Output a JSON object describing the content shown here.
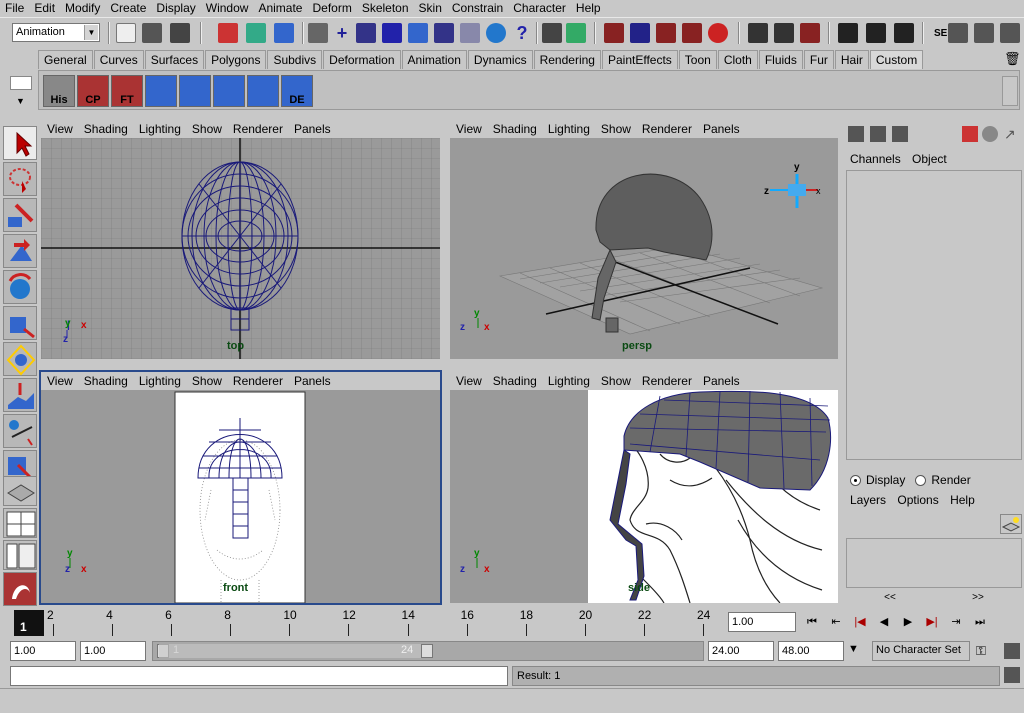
{
  "menubar": [
    "File",
    "Edit",
    "Modify",
    "Create",
    "Display",
    "Window",
    "Animate",
    "Deform",
    "Skeleton",
    "Skin",
    "Constrain",
    "Character",
    "Help"
  ],
  "statusline": {
    "mode": "Animation",
    "se_label": "SE"
  },
  "shelf": {
    "tabs": [
      "General",
      "Curves",
      "Surfaces",
      "Polygons",
      "Subdivs",
      "Deformation",
      "Animation",
      "Dynamics",
      "Rendering",
      "PaintEffects",
      "Toon",
      "Cloth",
      "Fluids",
      "Fur",
      "Hair",
      "Custom"
    ],
    "active_tab": "Custom",
    "buttons": [
      "His",
      "CP",
      "FT",
      "",
      "",
      "",
      "",
      "DE"
    ]
  },
  "viewport_menu": [
    "View",
    "Shading",
    "Lighting",
    "Show",
    "Renderer",
    "Panels"
  ],
  "viewports": {
    "top": "top",
    "persp": "persp",
    "front": "front",
    "side": "side"
  },
  "axes": {
    "x": "x",
    "y": "y",
    "z": "z"
  },
  "channelbox": {
    "menu": [
      "Channels",
      "Object"
    ]
  },
  "layers": {
    "display": "Display",
    "render": "Render",
    "menu": [
      "Layers",
      "Options",
      "Help"
    ],
    "nav_left": "<<",
    "nav_right": ">>"
  },
  "timeline": {
    "ticks": [
      "2",
      "4",
      "6",
      "8",
      "10",
      "12",
      "14",
      "16",
      "18",
      "20",
      "22",
      "24"
    ],
    "current": "1",
    "current_time": "1.00"
  },
  "range": {
    "start": "1.00",
    "playback_start": "1.00",
    "slider_start": "1",
    "slider_end": "24",
    "playback_end": "24.00",
    "end": "48.00",
    "character_set": "No Character Set"
  },
  "cmd": {
    "result": "Result: 1"
  },
  "colors": {
    "active_border": "#294a8c",
    "wire": "#1a1a7a",
    "label": "#0a4a12"
  }
}
